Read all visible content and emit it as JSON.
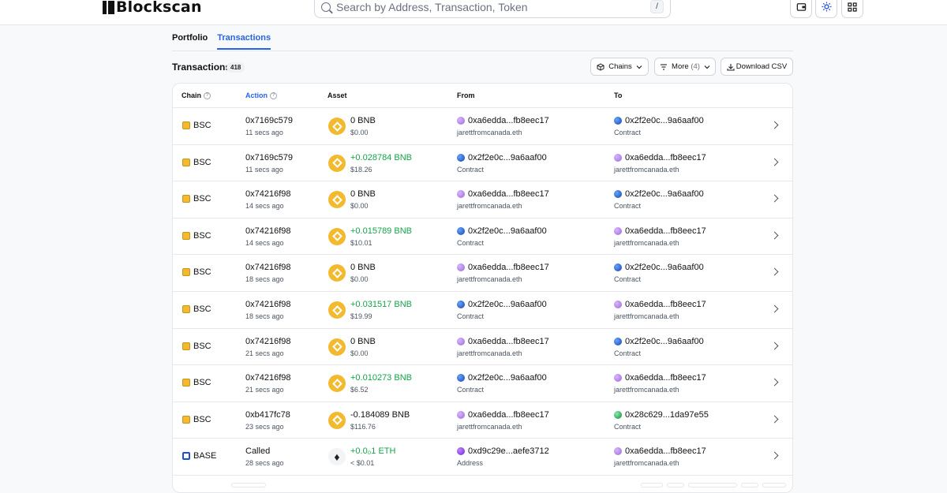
{
  "header": {
    "logo_text": "Blockscan",
    "search_placeholder": "Search by Address, Transaction, Token",
    "search_shortcut": "/",
    "icons": [
      "wallet-icon",
      "sun-icon",
      "grid-icon"
    ]
  },
  "tabs": [
    {
      "label": "Portfolio",
      "active": false
    },
    {
      "label": "Transactions",
      "active": true
    }
  ],
  "section": {
    "title": "Transactions",
    "count": "418",
    "chains_label": "Chains",
    "more_label": "More",
    "more_count": "(4)",
    "download_label": "Download CSV"
  },
  "table": {
    "headers": {
      "chain": "Chain",
      "action": "Action",
      "asset": "Asset",
      "from": "From",
      "to": "To"
    },
    "rows": [
      {
        "chain": "BSC",
        "chain_type": "bsc",
        "action": "0x7169c579",
        "time": "11 secs ago",
        "token": "bnb",
        "amount": "0 BNB",
        "positive": false,
        "usd": "$0.00",
        "from_addr": "0xa6edda...fb8eec17",
        "from_sub": "jarettfromcanada.eth",
        "from_avatar": "purple",
        "to_addr": "0x2f2e0c...9a6aaf00",
        "to_sub": "Contract",
        "to_avatar": "blue"
      },
      {
        "chain": "BSC",
        "chain_type": "bsc",
        "action": "0x7169c579",
        "time": "11 secs ago",
        "token": "bnb",
        "amount": "+0.028784 BNB",
        "positive": true,
        "usd": "$18.26",
        "from_addr": "0x2f2e0c...9a6aaf00",
        "from_sub": "Contract",
        "from_avatar": "blue",
        "to_addr": "0xa6edda...fb8eec17",
        "to_sub": "jarettfromcanada.eth",
        "to_avatar": "purple"
      },
      {
        "chain": "BSC",
        "chain_type": "bsc",
        "action": "0x74216f98",
        "time": "14 secs ago",
        "token": "bnb",
        "amount": "0 BNB",
        "positive": false,
        "usd": "$0.00",
        "from_addr": "0xa6edda...fb8eec17",
        "from_sub": "jarettfromcanada.eth",
        "from_avatar": "purple",
        "to_addr": "0x2f2e0c...9a6aaf00",
        "to_sub": "Contract",
        "to_avatar": "blue"
      },
      {
        "chain": "BSC",
        "chain_type": "bsc",
        "action": "0x74216f98",
        "time": "14 secs ago",
        "token": "bnb",
        "amount": "+0.015789 BNB",
        "positive": true,
        "usd": "$10.01",
        "from_addr": "0x2f2e0c...9a6aaf00",
        "from_sub": "Contract",
        "from_avatar": "blue",
        "to_addr": "0xa6edda...fb8eec17",
        "to_sub": "jarettfromcanada.eth",
        "to_avatar": "purple"
      },
      {
        "chain": "BSC",
        "chain_type": "bsc",
        "action": "0x74216f98",
        "time": "18 secs ago",
        "token": "bnb",
        "amount": "0 BNB",
        "positive": false,
        "usd": "$0.00",
        "from_addr": "0xa6edda...fb8eec17",
        "from_sub": "jarettfromcanada.eth",
        "from_avatar": "purple",
        "to_addr": "0x2f2e0c...9a6aaf00",
        "to_sub": "Contract",
        "to_avatar": "blue"
      },
      {
        "chain": "BSC",
        "chain_type": "bsc",
        "action": "0x74216f98",
        "time": "18 secs ago",
        "token": "bnb",
        "amount": "+0.031517 BNB",
        "positive": true,
        "usd": "$19.99",
        "from_addr": "0x2f2e0c...9a6aaf00",
        "from_sub": "Contract",
        "from_avatar": "blue",
        "to_addr": "0xa6edda...fb8eec17",
        "to_sub": "jarettfromcanada.eth",
        "to_avatar": "purple"
      },
      {
        "chain": "BSC",
        "chain_type": "bsc",
        "action": "0x74216f98",
        "time": "21 secs ago",
        "token": "bnb",
        "amount": "0 BNB",
        "positive": false,
        "usd": "$0.00",
        "from_addr": "0xa6edda...fb8eec17",
        "from_sub": "jarettfromcanada.eth",
        "from_avatar": "purple",
        "to_addr": "0x2f2e0c...9a6aaf00",
        "to_sub": "Contract",
        "to_avatar": "blue"
      },
      {
        "chain": "BSC",
        "chain_type": "bsc",
        "action": "0x74216f98",
        "time": "21 secs ago",
        "token": "bnb",
        "amount": "+0.010273 BNB",
        "positive": true,
        "usd": "$6.52",
        "from_addr": "0x2f2e0c...9a6aaf00",
        "from_sub": "Contract",
        "from_avatar": "blue",
        "to_addr": "0xa6edda...fb8eec17",
        "to_sub": "jarettfromcanada.eth",
        "to_avatar": "purple"
      },
      {
        "chain": "BSC",
        "chain_type": "bsc",
        "action": "0xb417fc78",
        "time": "23 secs ago",
        "token": "bnb",
        "amount": "-0.184089 BNB",
        "positive": false,
        "usd": "$116.76",
        "from_addr": "0xa6edda...fb8eec17",
        "from_sub": "jarettfromcanada.eth",
        "from_avatar": "purple",
        "to_addr": "0x28c629...1da97e55",
        "to_sub": "Contract",
        "to_avatar": "green"
      },
      {
        "chain": "BASE",
        "chain_type": "base",
        "action": "Called",
        "time": "28 secs ago",
        "token": "eth",
        "amount": "+0.0₀1 ETH",
        "positive": true,
        "usd": "< $0.01",
        "from_addr": "0xd9c29e...aefe3712",
        "from_sub": "Address",
        "from_avatar": "violet",
        "to_addr": "0xa6edda...fb8eec17",
        "to_sub": "jarettfromcanada.eth",
        "to_avatar": "purple"
      }
    ]
  },
  "colors": {
    "accent": "#2563eb",
    "positive": "#16a34a",
    "bnb": "#f3ba2f"
  }
}
